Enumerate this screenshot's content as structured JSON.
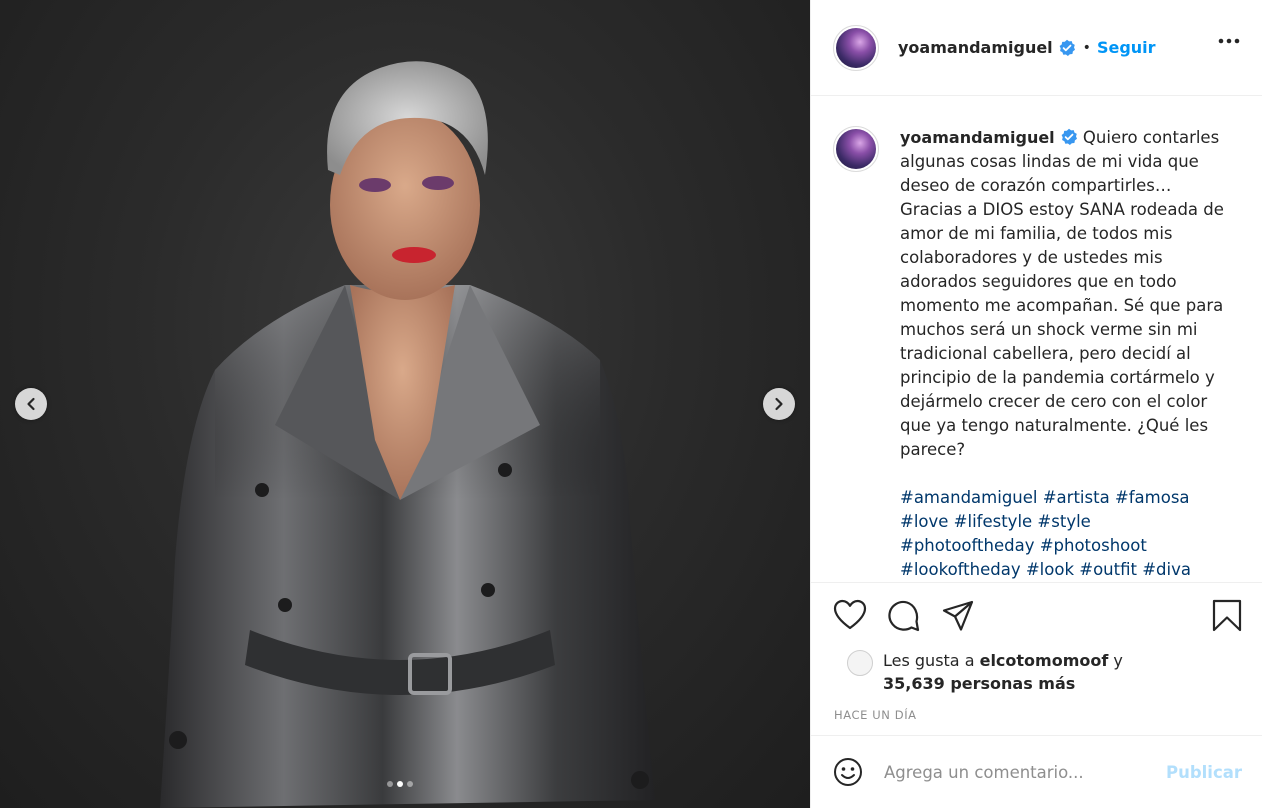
{
  "post": {
    "username": "yoamandamiguel",
    "follow_label": "Seguir",
    "separator": "•",
    "caption": "Quiero contarles algunas cosas lindas de mi vida que deseo de corazón compartirles… Gracias a DIOS estoy SANA rodeada de amor de mi familia, de todos mis colaboradores y de ustedes mis adorados seguidores que en todo momento me acompañan. Sé que para muchos será un shock verme sin mi tradicional cabellera, pero decidí al principio de la pandemia cortármelo y dejármelo crecer de cero con el color que ya tengo naturalmente. ¿Qué les parece?",
    "hashtags": "#amandamiguel #artista #famosa #love #lifestyle #style #photooftheday #photoshoot #lookoftheday #look #outfit #diva #newstyle #luxury",
    "likes_prefix": "Les gusta a",
    "likes_user": "elcotomomoof",
    "likes_and": "y",
    "likes_count": "35,639 personas más",
    "timestamp": "HACE UN DÍA",
    "comment_placeholder": "Agrega un comentario...",
    "publish_label": "Publicar"
  },
  "carousel": {
    "current": 2,
    "total": 3
  },
  "colors": {
    "follow": "#0095f6",
    "hashtag": "#00376b",
    "verified": "#3897f0",
    "publish_disabled": "#b2dffc"
  },
  "icons": [
    "verified-badge-icon",
    "more-options-icon",
    "heart-icon",
    "comment-icon",
    "share-icon",
    "bookmark-icon",
    "emoji-icon",
    "chevron-left-icon",
    "chevron-right-icon"
  ]
}
